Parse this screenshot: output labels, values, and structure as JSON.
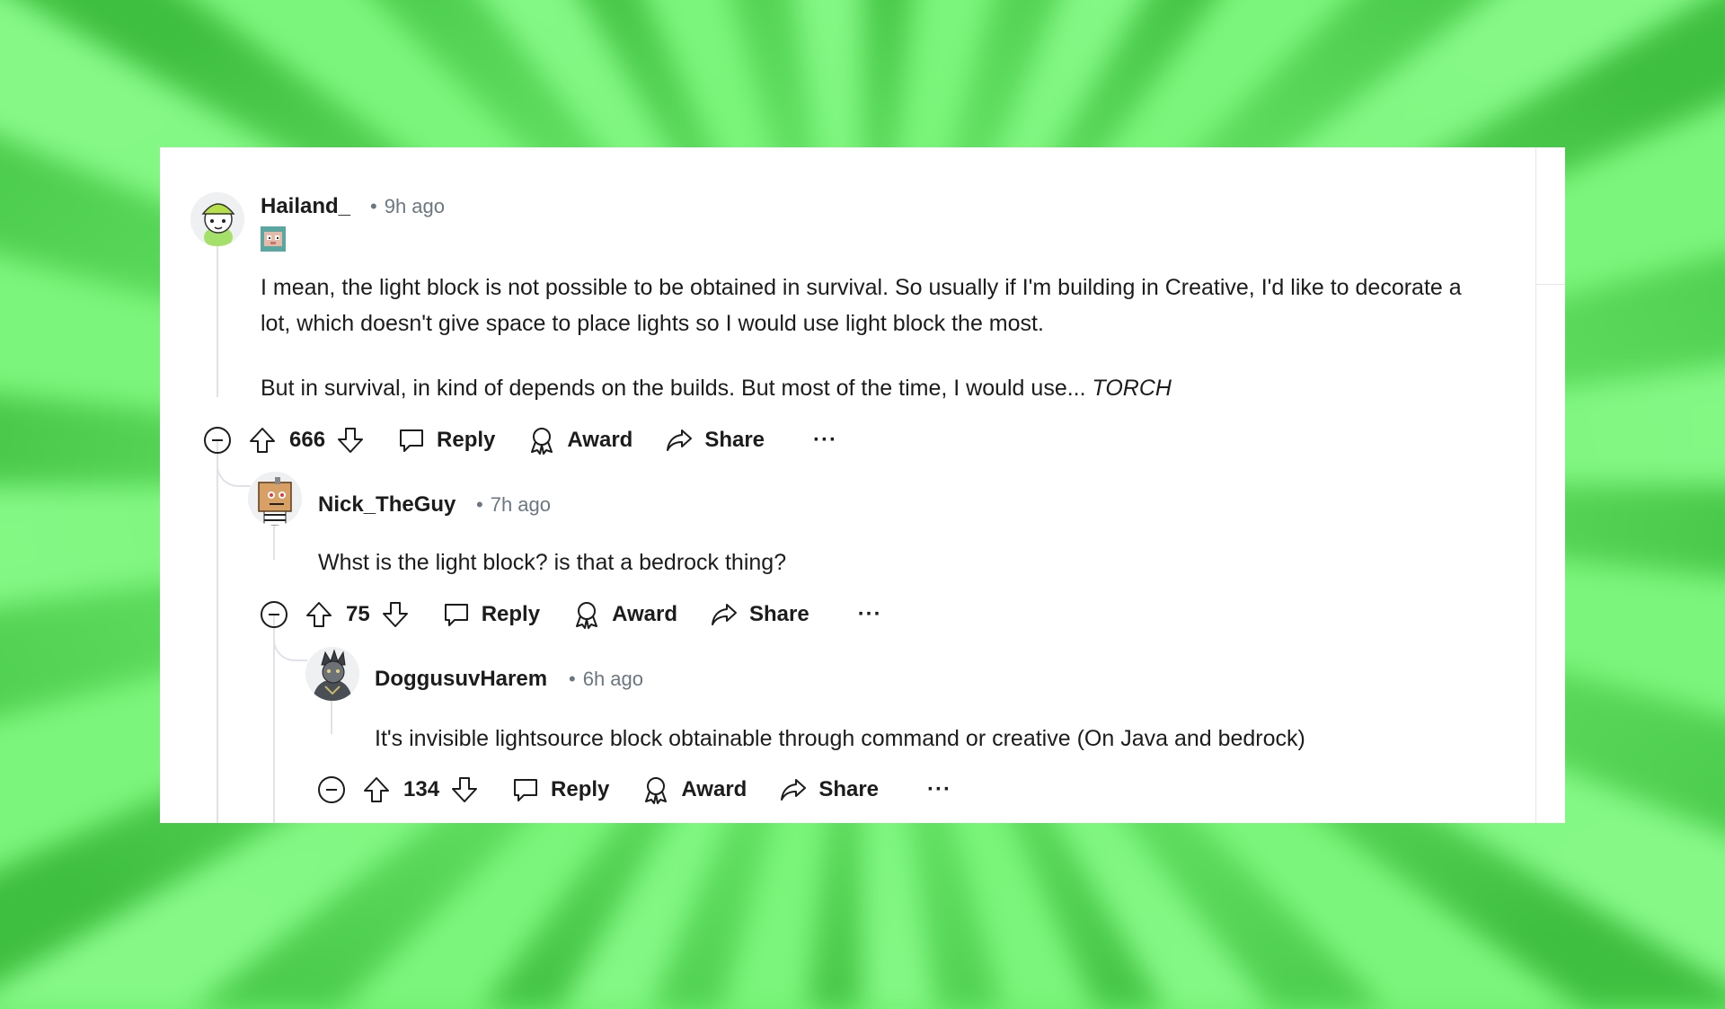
{
  "comments": [
    {
      "username": "Hailand_",
      "time": "9h ago",
      "has_flair": true,
      "paragraphs": [
        "I mean, the light block is not possible to be obtained in survival. So usually if I'm building in Creative, I'd like to decorate a lot, which doesn't give space to place lights so I would use light block the most.",
        "But in survival, in kind of depends on the builds. But most of the time, I would use... "
      ],
      "emphasis": "TORCH",
      "votes": "666",
      "actions": {
        "reply": "Reply",
        "award": "Award",
        "share": "Share",
        "more": "···"
      }
    },
    {
      "username": "Nick_TheGuy",
      "time": "7h ago",
      "paragraphs": [
        "Whst is the light block? is that a bedrock thing?"
      ],
      "votes": "75",
      "actions": {
        "reply": "Reply",
        "award": "Award",
        "share": "Share",
        "more": "···"
      }
    },
    {
      "username": "DoggusuvHarem",
      "time": "6h ago",
      "paragraphs": [
        "It's invisible lightsource block obtainable through command or creative (On Java and bedrock)"
      ],
      "votes": "134",
      "actions": {
        "reply": "Reply",
        "award": "Award",
        "share": "Share",
        "more": "···"
      }
    }
  ],
  "separator": "•",
  "icons": {
    "collapse": "minus-circle-icon",
    "upvote": "arrow-up-icon",
    "downvote": "arrow-down-icon",
    "reply": "comment-bubble-icon",
    "award": "award-ribbon-icon",
    "share": "share-arrow-icon"
  },
  "colors": {
    "text": "#1c1c1c",
    "meta": "#6b7780",
    "thread": "#dfe3e6",
    "background": "#6fef6f"
  }
}
